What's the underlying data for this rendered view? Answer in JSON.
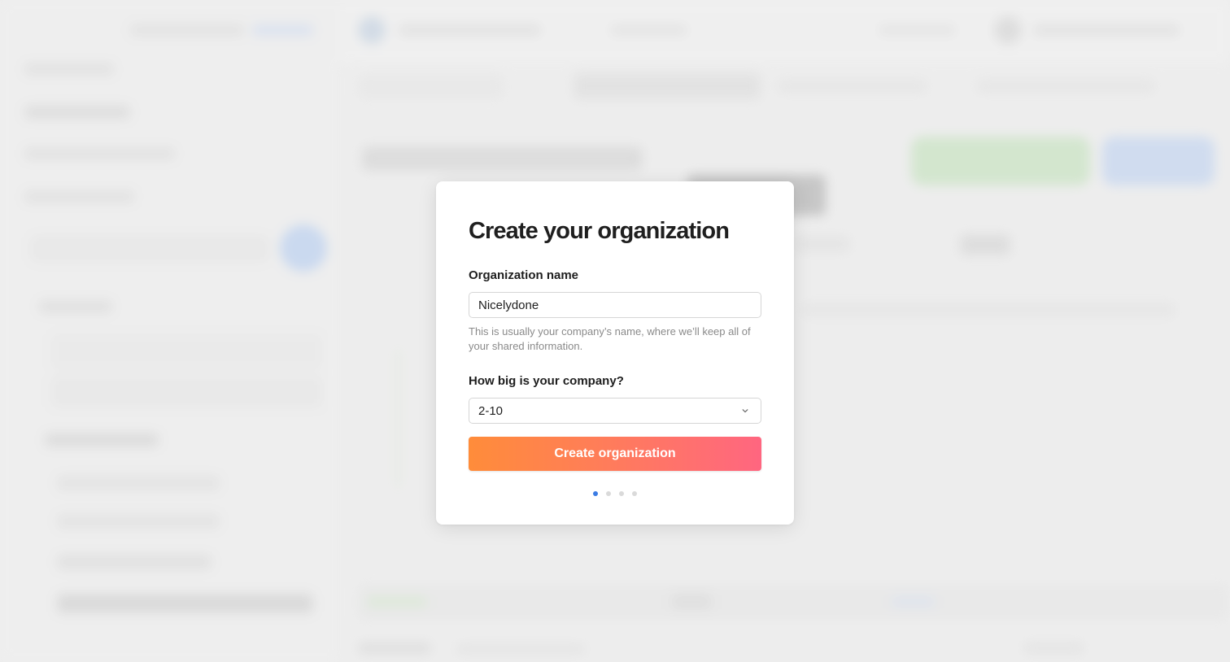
{
  "modal": {
    "title": "Create your organization",
    "org_name": {
      "label": "Organization name",
      "value": "Nicelydone",
      "help": "This is usually your company’s name, where we’ll keep all of your shared information."
    },
    "company_size": {
      "label": "How big is your company?",
      "selected": "2-10"
    },
    "submit_label": "Create organization",
    "steps": {
      "total": 4,
      "current": 1
    }
  },
  "colors": {
    "button_gradient_start": "#ff8c3a",
    "button_gradient_end": "#ff6680",
    "active_dot": "#3b7ce4",
    "inactive_dot": "#dadada"
  },
  "icons": {
    "select_chevron": "chevron-down-icon"
  }
}
